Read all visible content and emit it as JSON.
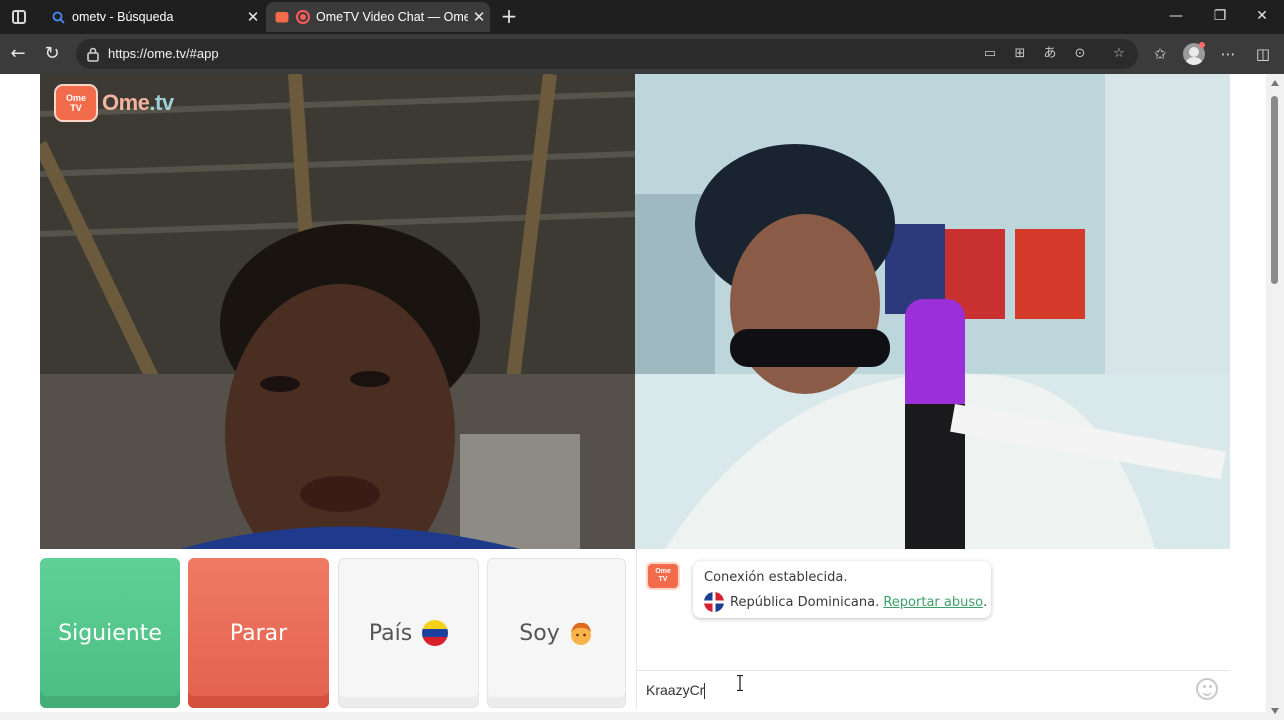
{
  "browser": {
    "tabs": [
      {
        "title": "ometv - Búsqueda",
        "active": false,
        "icon": "search-icon"
      },
      {
        "title": "OmeTV Video Chat — Omegle",
        "active": true,
        "icon": "ometv-favicon"
      }
    ],
    "url": "https://ome.tv/#app"
  },
  "app": {
    "logo": {
      "tv_top": "Ome",
      "tv_bottom": "TV",
      "name_a": "Ome",
      "name_b": ".tv"
    },
    "buttons": {
      "next": "Siguiente",
      "stop": "Parar",
      "country": "País",
      "gender": "Soy"
    },
    "chat": {
      "connection_message": "Conexión establecida.",
      "country": "República Dominicana.",
      "report_link": "Reportar abuso",
      "report_suffix": ".",
      "input_value": "KraazyCr"
    }
  },
  "colors": {
    "next_button": "#4cbd82",
    "stop_button": "#e2614c",
    "link": "#3fa06b",
    "brand": "#f26b4a"
  }
}
